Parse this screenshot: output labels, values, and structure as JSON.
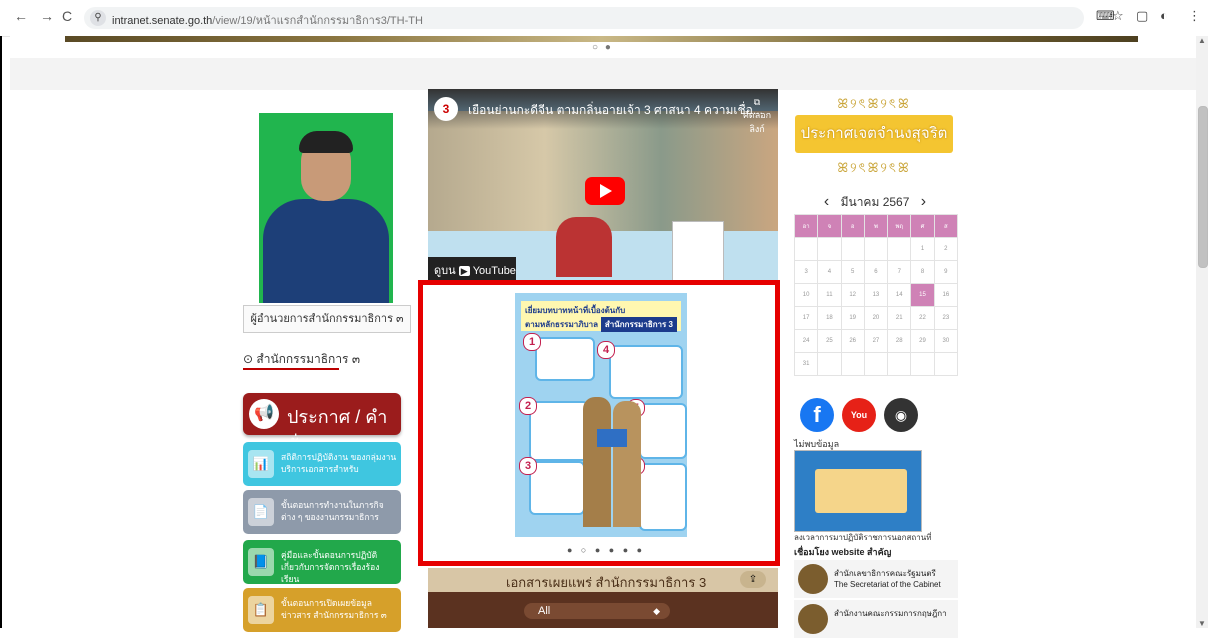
{
  "browser": {
    "url_domain": "intranet.senate.go.th",
    "url_path": "/view/19/หน้าแรกสำนักกรรมาธิการ3/TH-TH",
    "back": "←",
    "forward": "→",
    "reload": "C",
    "icons": [
      "translate-icon",
      "star-icon",
      "side-panel-icon",
      "profile-icon",
      "menu-icon"
    ]
  },
  "slider_top": {
    "dots": "○ ●"
  },
  "left": {
    "photo_caption": "ผู้อำนวยการสำนักกรรมาธิการ ๓",
    "office_title": "⊙ สำนักกรรมาธิการ ๓",
    "announce_label": "ประกาศ / คำสั่ง",
    "tiles": [
      {
        "label": "สถิติการปฏิบัติงาน ของกลุ่มงานบริการเอกสารสำหรับ",
        "color": "#3fc6e0"
      },
      {
        "label": "ขั้นตอนการทำงานในภารกิจต่าง ๆ ของงานกรรมาธิการ",
        "color": "#8e9aaa"
      },
      {
        "label": "คู่มือและขั้นตอนการปฏิบัติ เกี่ยวกับการจัดการเรื่องร้องเรียน",
        "color": "#22a84b"
      },
      {
        "label": "ขั้นตอนการเปิดเผยข้อมูลข่าวสาร สำนักกรรมาธิการ ๓",
        "color": "#d6a02a"
      }
    ]
  },
  "video": {
    "channel_badge": "3",
    "title": "เยือนย่านกะดีจีน ตามกลิ่นอายเจ้า 3 ศาสนา 4 ความเชื่อ...",
    "copy_label": "คัดลอกลิงก์",
    "watch_on": "ดูบน",
    "youtube": "YouTube"
  },
  "poster": {
    "header_line1": "เยี่ยมบทบาทหน้าที่เบื้องต้นกับ",
    "header_line2": "ตามหลักธรรมาภิบาล",
    "header_tag": "สำนักกรรมาธิการ 3",
    "items": [
      "1",
      "2",
      "3",
      "4",
      "5",
      "6"
    ],
    "dots": "● ○ ● ● ● ●"
  },
  "docs": {
    "title": "เอกสารเผยแพร่ สำนักกรรมาธิการ 3",
    "share_icon": "share-icon",
    "select_value": "All"
  },
  "right": {
    "notice_text": "ประกาศเจตจำนงสุจริต",
    "ornament": "ꕤ୨ৎꕤ୨ৎꕤ",
    "calendar": {
      "prev": "‹",
      "next": "›",
      "month_year": "มีนาคม 2567",
      "weekdays": [
        "อา",
        "จ",
        "อ",
        "พ",
        "พฤ",
        "ศ",
        "ส"
      ],
      "weeks": [
        [
          "",
          "",
          "",
          "",
          "",
          "1",
          "2"
        ],
        [
          "3",
          "4",
          "5",
          "6",
          "7",
          "8",
          "9"
        ],
        [
          "10",
          "11",
          "12",
          "13",
          "14",
          "15",
          "16"
        ],
        [
          "17",
          "18",
          "19",
          "20",
          "21",
          "22",
          "23"
        ],
        [
          "24",
          "25",
          "26",
          "27",
          "28",
          "29",
          "30"
        ],
        [
          "31",
          "",
          "",
          "",
          "",
          "",
          ""
        ]
      ],
      "today": "15"
    },
    "social": [
      {
        "icon": "facebook-icon",
        "glyph": "f",
        "color": "#1877f2"
      },
      {
        "icon": "youtube-icon",
        "glyph": "You",
        "color": "#e62117"
      },
      {
        "icon": "website-icon",
        "glyph": "◉",
        "color": "#333333"
      }
    ],
    "no_data": "ไม่พบข้อมูล",
    "system_label": "ลงเวลาการมาปฏิบัติราชการนอกสถานที่",
    "links_title": "เชื่อมโยง website สำคัญ",
    "links": [
      {
        "line1": "สำนักเลขาธิการคณะรัฐมนตรี",
        "line2": "The Secretariat of the Cabinet"
      },
      {
        "line1": "สำนักงานคณะกรรมการกฤษฎีกา",
        "line2": ""
      }
    ]
  }
}
